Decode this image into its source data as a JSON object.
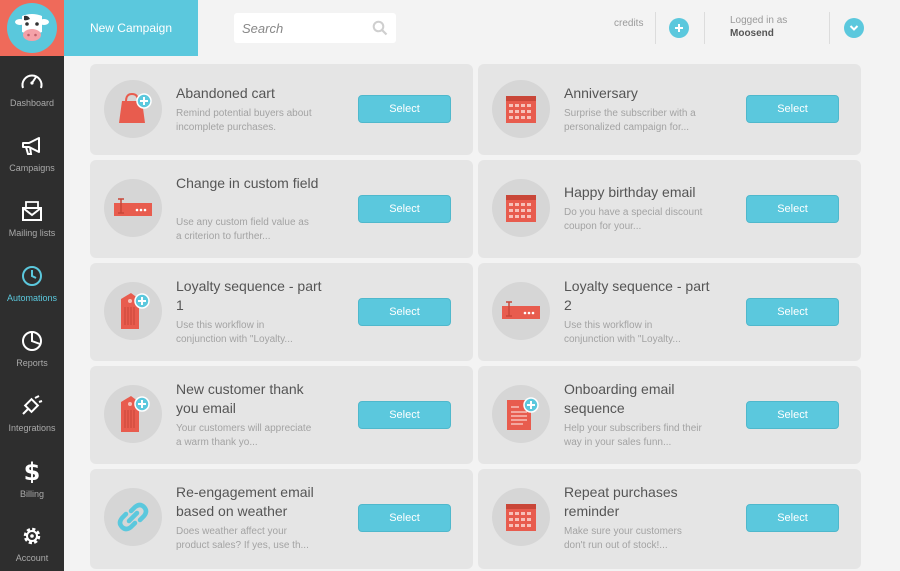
{
  "header": {
    "new_campaign": "New Campaign",
    "search_placeholder": "Search",
    "credits_label": "credits",
    "logged_in_label": "Logged in as",
    "username": "Moosend"
  },
  "sidebar": {
    "items": [
      {
        "label": "Dashboard",
        "icon": "dashboard-icon"
      },
      {
        "label": "Campaigns",
        "icon": "megaphone-icon"
      },
      {
        "label": "Mailing lists",
        "icon": "envelope-icon"
      },
      {
        "label": "Automations",
        "icon": "clock-icon",
        "active": true
      },
      {
        "label": "Reports",
        "icon": "pie-chart-icon"
      },
      {
        "label": "Integrations",
        "icon": "plug-icon"
      },
      {
        "label": "Billing",
        "icon": "dollar-icon"
      },
      {
        "label": "Account",
        "icon": "gear-icon"
      }
    ]
  },
  "cards": [
    {
      "title": "Abandoned cart",
      "desc": "Remind potential buyers about incomplete purchases.",
      "icon": "shopping-bag-icon",
      "button": "Select"
    },
    {
      "title": "Anniversary",
      "desc": "Surprise the subscriber with a personalized campaign for...",
      "icon": "calendar-icon",
      "button": "Select"
    },
    {
      "title": "Change in custom field",
      "desc": "Use any custom field value as a criterion to further...",
      "icon": "input-field-icon",
      "button": "Select"
    },
    {
      "title": "Happy birthday email",
      "desc": "Do you have a special discount coupon for your...",
      "icon": "calendar-icon",
      "button": "Select"
    },
    {
      "title": "Loyalty sequence - part 1",
      "desc": "Use this workflow in conjunction with \"Loyalty...",
      "icon": "tag-icon",
      "button": "Select"
    },
    {
      "title": "Loyalty sequence - part 2",
      "desc": "Use this workflow in conjunction with \"Loyalty...",
      "icon": "input-field-icon",
      "button": "Select"
    },
    {
      "title": "New customer thank you email",
      "desc": "Your customers will appreciate a warm thank yo...",
      "icon": "tag-icon",
      "button": "Select"
    },
    {
      "title": "Onboarding email sequence",
      "desc": "Help your subscribers find their way in your sales funn...",
      "icon": "document-icon",
      "button": "Select"
    },
    {
      "title": "Re-engagement email based on weather",
      "desc": "Does weather affect your product sales? If yes, use th...",
      "icon": "link-icon",
      "button": "Select"
    },
    {
      "title": "Repeat purchases reminder",
      "desc": "Make sure your customers don't run out of stock!...",
      "icon": "calendar-icon",
      "button": "Select"
    }
  ],
  "colors": {
    "accent": "#5bc8dd",
    "brand": "#ef6a5a",
    "sidebar": "#2e2e2e"
  }
}
